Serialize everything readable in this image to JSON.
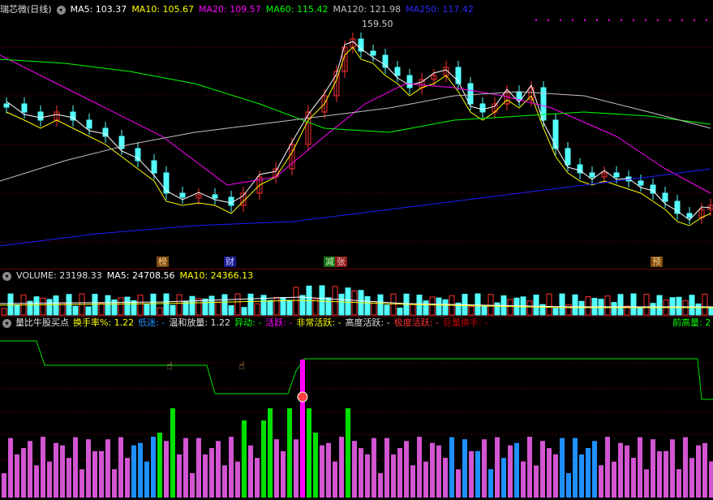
{
  "main_header": {
    "title": "瑞芯微(日线)",
    "ma5": "MA5: 103.37",
    "ma10": "MA10: 105.67",
    "ma20": "MA20: 109.57",
    "ma60": "MA60: 115.42",
    "ma120": "MA120: 121.98",
    "ma250": "MA250: 117.42"
  },
  "price_label": "159.50",
  "event_tags": [
    "榜",
    "财",
    "减",
    "张",
    "预"
  ],
  "volume_header": {
    "title": "VOLUME: 23198.33",
    "ma5": "MA5: 24708.56",
    "ma10": "MA10: 24366.13"
  },
  "indicator_header": {
    "title": "量比牛股买点",
    "turnover": "换手率%: 1.22",
    "low": "低迷: -",
    "mild": "温和放量: 1.22",
    "abnormal": "异动: -",
    "active": "活跃: -",
    "very_active": "非常活跃: -",
    "high_active": "高度活跃: -",
    "extreme_active": "极度活跃: -",
    "huge": "巨量换手: -",
    "prev_high": "前高量: 2"
  },
  "colors": {
    "up": "#ff3232",
    "down": "#54ffff",
    "ma5": "#ffffff",
    "ma10": "#ffff00",
    "ma20": "#ff00ff",
    "ma60": "#00ff00",
    "ma120": "#c0c0c0",
    "ma250": "#1e1eff",
    "indicator_bar": "#d255d2",
    "indicator_low": "#1e90ff",
    "indicator_green": "#00e000"
  },
  "icons": [
    "collapse-circle-icon",
    "hand-cursor-icon",
    "red-ball-marker-icon"
  ]
}
